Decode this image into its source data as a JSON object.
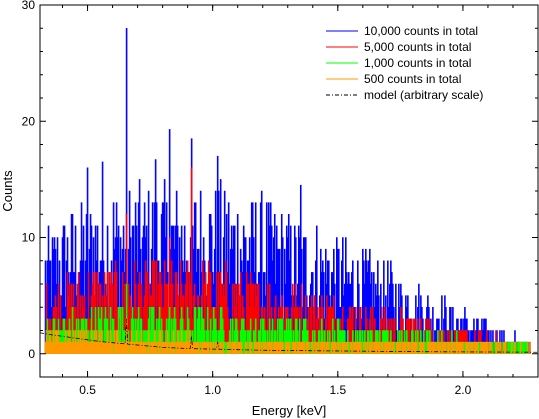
{
  "chart_data": {
    "type": "line",
    "title": "",
    "xlabel": "Energy [keV]",
    "ylabel": "Counts",
    "xlim": [
      0.31,
      2.3
    ],
    "ylim": [
      -2,
      30
    ],
    "xticks": [
      0.5,
      1.0,
      1.5,
      2.0
    ],
    "xtick_labels": [
      "0.5",
      "1.0",
      "1.5",
      "2.0"
    ],
    "yticks": [
      0,
      10,
      20,
      30
    ],
    "ytick_labels": [
      "0",
      "10",
      "20",
      "30"
    ],
    "grid": false,
    "legend_position": "top-right",
    "series": [
      {
        "name": "10,000 counts in total",
        "color": "#0000ff",
        "style": "histogram",
        "envelope_x": [
          0.33,
          0.4,
          0.5,
          0.6,
          0.7,
          0.8,
          0.9,
          1.0,
          1.1,
          1.2,
          1.3,
          1.4,
          1.5,
          1.6,
          1.7,
          1.8,
          1.9,
          2.0,
          2.1,
          2.2,
          2.27
        ],
        "envelope_y": [
          9,
          11,
          12,
          13,
          13,
          13,
          13,
          13,
          12.5,
          12,
          11,
          10,
          9,
          8,
          7,
          5.5,
          4.5,
          3.5,
          2.5,
          1.5,
          1
        ],
        "peaks": [
          [
            0.654,
            28
          ],
          [
            0.916,
            18.5
          ],
          [
            0.825,
            19.3
          ],
          [
            1.02,
            17
          ],
          [
            0.5,
            16
          ],
          [
            0.56,
            16.5
          ],
          [
            0.77,
            16.7
          ],
          [
            1.35,
            14.5
          ]
        ]
      },
      {
        "name": "5,000 counts in total",
        "color": "#ff0000",
        "style": "histogram",
        "envelope_x": [
          0.33,
          0.4,
          0.5,
          0.6,
          0.7,
          0.8,
          0.9,
          1.0,
          1.1,
          1.2,
          1.3,
          1.4,
          1.5,
          1.6,
          1.7,
          1.8,
          1.9,
          2.0,
          2.1,
          2.2,
          2.27
        ],
        "envelope_y": [
          5,
          6,
          6.5,
          7,
          7,
          7,
          7,
          7,
          6.5,
          6,
          5.5,
          5,
          4.5,
          4,
          3.5,
          3,
          2.5,
          2,
          1.5,
          1,
          0.5
        ],
        "peaks": [
          [
            0.654,
            12
          ],
          [
            0.916,
            16
          ],
          [
            0.825,
            10
          ]
        ]
      },
      {
        "name": "1,000 counts in total",
        "color": "#00ff00",
        "style": "histogram",
        "envelope_x": [
          0.33,
          0.4,
          0.5,
          0.6,
          0.7,
          0.8,
          0.9,
          1.0,
          1.1,
          1.2,
          1.3,
          1.4,
          1.5,
          1.6,
          1.7,
          1.8,
          1.9,
          2.0,
          2.1,
          2.2,
          2.27
        ],
        "envelope_y": [
          2.5,
          3,
          3.5,
          3.5,
          3.5,
          3.5,
          3.5,
          3.5,
          3,
          3,
          3,
          2.5,
          2.5,
          2,
          2,
          2,
          1.5,
          1.5,
          1,
          1,
          0.5
        ],
        "peaks": [
          [
            0.654,
            6
          ]
        ]
      },
      {
        "name": "500 counts in total",
        "color": "#ff9900",
        "style": "histogram",
        "envelope_x": [
          0.33,
          0.4,
          0.5,
          0.6,
          0.7,
          0.8,
          0.9,
          1.0,
          1.1,
          1.2,
          1.3,
          1.4,
          1.5,
          1.6,
          1.7,
          1.8,
          1.9,
          2.0,
          2.1,
          2.2,
          2.27
        ],
        "envelope_y": [
          2,
          2,
          2,
          1.5,
          1.5,
          1.5,
          1.5,
          1,
          1,
          1,
          1,
          1,
          1,
          1,
          1,
          1,
          1,
          1,
          1,
          0.5,
          0.5
        ],
        "peaks": [
          [
            0.654,
            3
          ]
        ]
      },
      {
        "name": "model (arbitrary scale)",
        "color": "#000000",
        "style": "dashdot",
        "x": [
          0.31,
          0.35,
          0.4,
          0.45,
          0.5,
          0.55,
          0.6,
          0.65,
          0.7,
          0.75,
          0.8,
          0.9,
          1.0,
          1.1,
          1.2,
          1.3,
          1.4,
          1.5,
          1.7,
          1.9,
          2.1,
          2.3
        ],
        "y": [
          1.8,
          1.65,
          1.5,
          1.35,
          1.2,
          1.05,
          0.95,
          0.85,
          0.75,
          0.65,
          0.55,
          0.45,
          0.4,
          0.35,
          0.3,
          0.28,
          0.26,
          0.24,
          0.2,
          0.17,
          0.15,
          0.13
        ],
        "peaks": [
          [
            0.654,
            3
          ],
          [
            0.916,
            1.5
          ],
          [
            1.02,
            1
          ]
        ]
      }
    ]
  }
}
